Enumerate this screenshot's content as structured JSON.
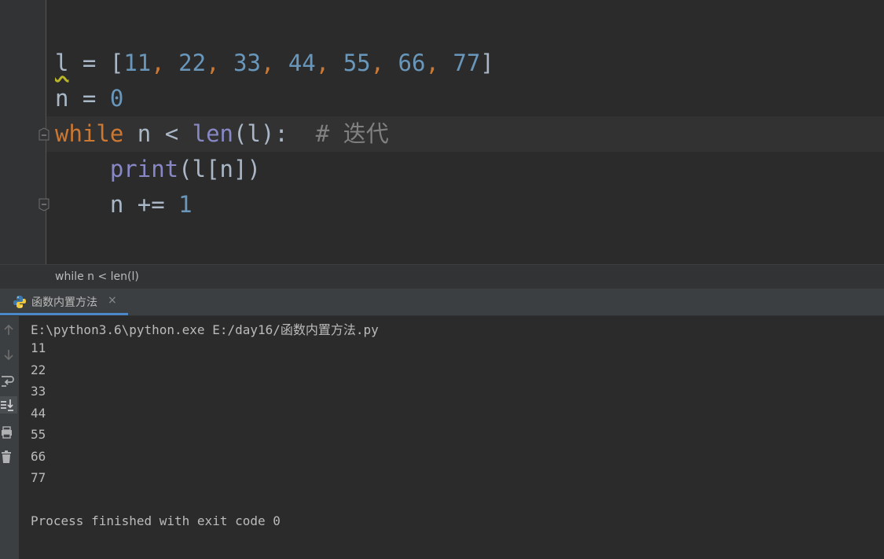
{
  "editor": {
    "line1": {
      "var": "l",
      "assign": " = [",
      "nums": [
        "11",
        "22",
        "33",
        "44",
        "55",
        "66",
        "77"
      ],
      "sep": ", ",
      "close": "]"
    },
    "line2": {
      "var": "n",
      "assign": " = ",
      "value": "0"
    },
    "line3": {
      "keyword": "while",
      "cond_a": " n < ",
      "builtin": "len",
      "cond_b": "(l):  ",
      "comment": "# 迭代"
    },
    "line4": {
      "indent": "    ",
      "builtin": "print",
      "args": "(l[n])"
    },
    "line5": {
      "indent": "    ",
      "text": "n += ",
      "value": "1"
    }
  },
  "breadcrumb": {
    "text": "while n < len(l)"
  },
  "run_tab": {
    "label": "函数内置方法",
    "close": "×"
  },
  "console": {
    "command": "E:\\python3.6\\python.exe E:/day16/函数内置方法.py",
    "output": [
      "11",
      "22",
      "33",
      "44",
      "55",
      "66",
      "77"
    ],
    "finish": "Process finished with exit code 0"
  },
  "tools": [
    "up-arrow-icon",
    "down-arrow-icon",
    "soft-wrap-icon",
    "scroll-to-end-icon",
    "print-icon",
    "trash-icon"
  ],
  "colors": {
    "keyword": "#cc7832",
    "number": "#6897bb",
    "builtin": "#8888c6",
    "comment": "#808080",
    "text": "#a9b7c6",
    "accent": "#4a88c7"
  }
}
